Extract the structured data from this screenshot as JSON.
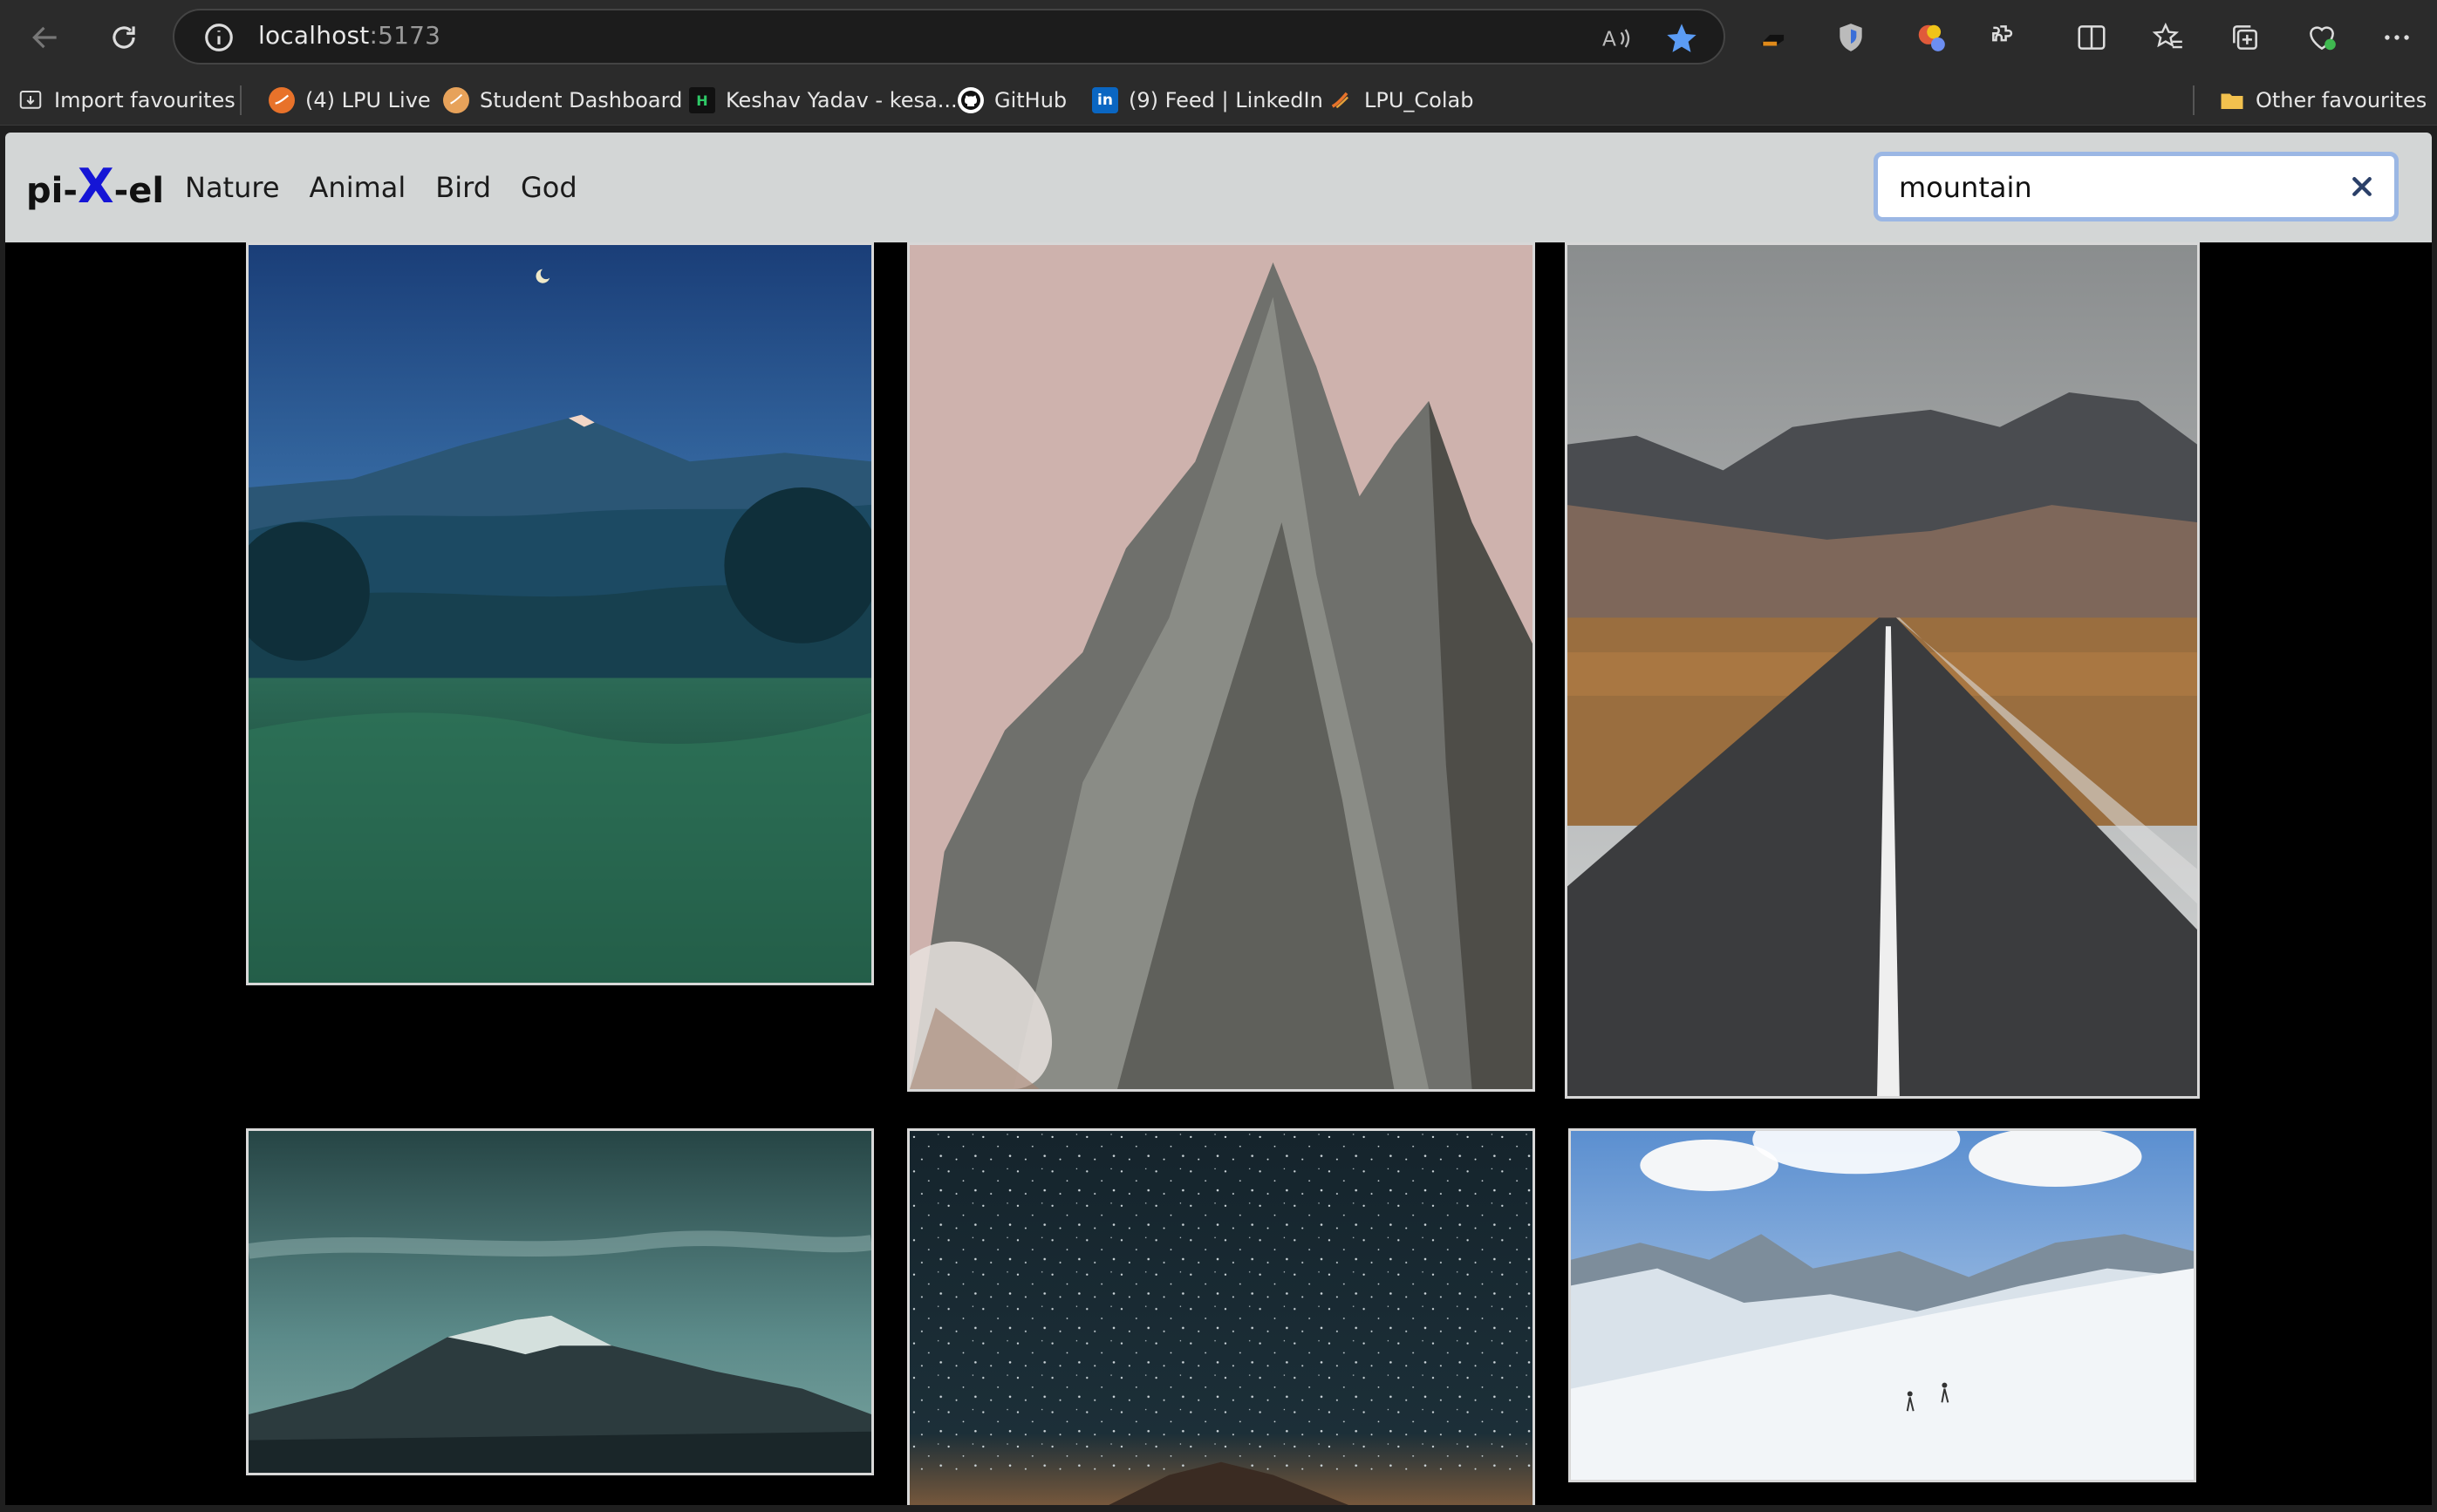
{
  "browser": {
    "url_host": "localhost",
    "url_port": ":5173",
    "bookmarks": [
      {
        "label": "Import favourites",
        "icon": "import-icon"
      },
      {
        "label": "(4) LPU Live",
        "icon": "lpu-live-icon"
      },
      {
        "label": "Student Dashboard",
        "icon": "dashboard-icon"
      },
      {
        "label": "Keshav Yadav - kesa...",
        "icon": "hackerrank-icon"
      },
      {
        "label": "GitHub",
        "icon": "github-icon"
      },
      {
        "label": "(9) Feed | LinkedIn",
        "icon": "linkedin-icon"
      },
      {
        "label": "LPU_Colab",
        "icon": "colab-icon"
      }
    ],
    "other_favourites": "Other favourites"
  },
  "app": {
    "brand_prefix": "pi-",
    "brand_x": "X",
    "brand_suffix": "-el",
    "nav": [
      "Nature",
      "Animal",
      "Bird",
      "God"
    ],
    "search_value": "mountain"
  },
  "gallery": [
    {
      "name": "volcano-night-valley",
      "description": "mountain"
    },
    {
      "name": "rocky-peak",
      "description": "mountain"
    },
    {
      "name": "mountain-road",
      "description": "mountain"
    },
    {
      "name": "snowy-mountain-dusk",
      "description": "mountain"
    },
    {
      "name": "starry-sky-mountain",
      "description": "mountain"
    },
    {
      "name": "snow-hikers",
      "description": "mountain"
    }
  ],
  "colors": {
    "navbar_bg": "#d3d6d6",
    "brand_x": "#1515d6",
    "search_focus": "#9bb7e4",
    "page_bg": "#000000"
  }
}
